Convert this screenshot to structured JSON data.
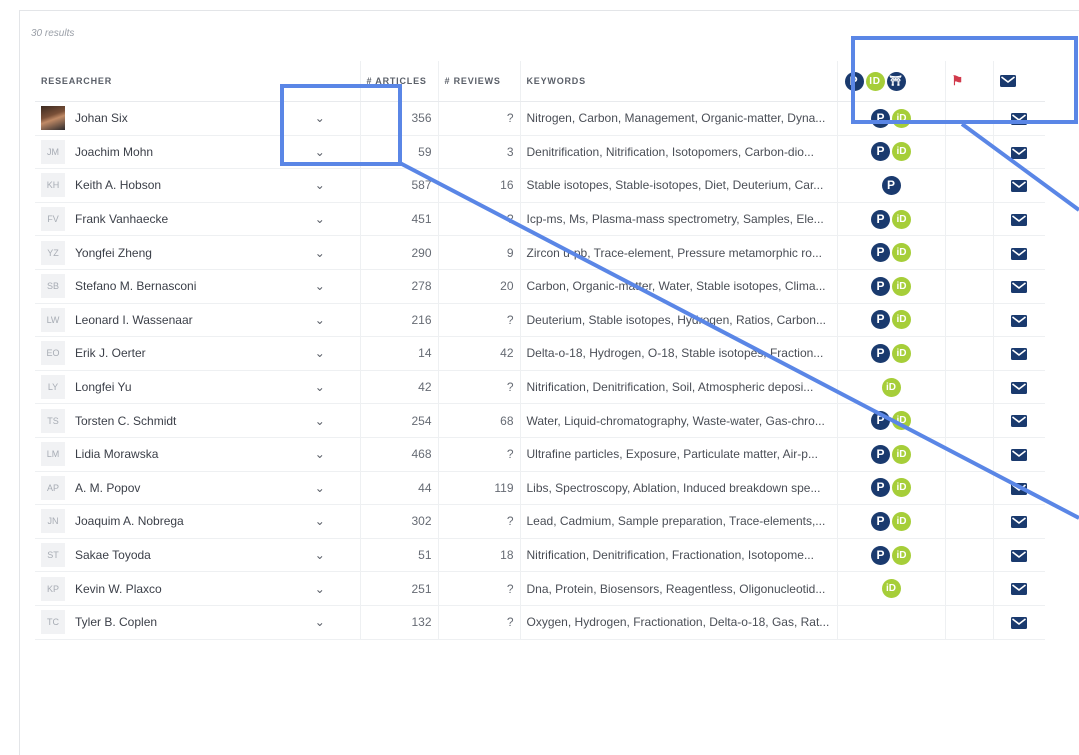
{
  "results_label": "30 results",
  "columns": {
    "researcher": "RESEARCHER",
    "articles": "# ARTICLES",
    "reviews": "# REVIEWS",
    "keywords": "KEYWORDS"
  },
  "header_icons": [
    "publons-icon",
    "orcid-icon",
    "institution-icon",
    "flag-icon",
    "mail-icon"
  ],
  "colors": {
    "highlight": "#5a86e6",
    "publons": "#1a3a6e",
    "orcid": "#a6ce39",
    "flag": "#d13a4c",
    "mail": "#1a3a6e"
  },
  "rows": [
    {
      "initials": "",
      "photo": true,
      "name": "Johan Six",
      "articles": "356",
      "reviews": "?",
      "keywords": "Nitrogen, Carbon, Management, Organic-matter, Dyna...",
      "pub": true,
      "orcid": true
    },
    {
      "initials": "JM",
      "name": "Joachim Mohn",
      "articles": "59",
      "reviews": "3",
      "keywords": "Denitrification, Nitrification, Isotopomers, Carbon-dio...",
      "pub": true,
      "orcid": true
    },
    {
      "initials": "KH",
      "name": "Keith A. Hobson",
      "articles": "587",
      "reviews": "16",
      "keywords": "Stable isotopes, Stable-isotopes, Diet, Deuterium, Car...",
      "pub": true,
      "orcid": false
    },
    {
      "initials": "FV",
      "name": "Frank Vanhaecke",
      "articles": "451",
      "reviews": "?",
      "keywords": "Icp-ms, Ms, Plasma-mass spectrometry, Samples, Ele...",
      "pub": true,
      "orcid": true
    },
    {
      "initials": "YZ",
      "name": "Yongfei Zheng",
      "articles": "290",
      "reviews": "9",
      "keywords": "Zircon u-pb, Trace-element, Pressure metamorphic ro...",
      "pub": true,
      "orcid": true
    },
    {
      "initials": "SB",
      "name": "Stefano M. Bernasconi",
      "articles": "278",
      "reviews": "20",
      "keywords": "Carbon, Organic-matter, Water, Stable isotopes, Clima...",
      "pub": true,
      "orcid": true
    },
    {
      "initials": "LW",
      "name": "Leonard I. Wassenaar",
      "articles": "216",
      "reviews": "?",
      "keywords": "Deuterium, Stable isotopes, Hydrogen, Ratios, Carbon...",
      "pub": true,
      "orcid": true
    },
    {
      "initials": "EO",
      "name": "Erik J. Oerter",
      "articles": "14",
      "reviews": "42",
      "keywords": "Delta-o-18, Hydrogen, O-18, Stable isotopes, Fraction...",
      "pub": true,
      "orcid": true
    },
    {
      "initials": "LY",
      "name": "Longfei Yu",
      "articles": "42",
      "reviews": "?",
      "keywords": "Nitrification, Denitrification, Soil, Atmospheric deposi...",
      "pub": false,
      "orcid": true
    },
    {
      "initials": "TS",
      "name": "Torsten C. Schmidt",
      "articles": "254",
      "reviews": "68",
      "keywords": "Water, Liquid-chromatography, Waste-water, Gas-chro...",
      "pub": true,
      "orcid": true
    },
    {
      "initials": "LM",
      "name": "Lidia Morawska",
      "articles": "468",
      "reviews": "?",
      "keywords": "Ultrafine particles, Exposure, Particulate matter, Air-p...",
      "pub": true,
      "orcid": true
    },
    {
      "initials": "AP",
      "name": "A. M. Popov",
      "articles": "44",
      "reviews": "119",
      "keywords": "Libs, Spectroscopy, Ablation, Induced breakdown spe...",
      "pub": true,
      "orcid": true
    },
    {
      "initials": "JN",
      "name": "Joaquim A. Nobrega",
      "articles": "302",
      "reviews": "?",
      "keywords": "Lead, Cadmium, Sample preparation, Trace-elements,...",
      "pub": true,
      "orcid": true
    },
    {
      "initials": "ST",
      "name": "Sakae Toyoda",
      "articles": "51",
      "reviews": "18",
      "keywords": "Nitrification, Denitrification, Fractionation, Isotopome...",
      "pub": true,
      "orcid": true
    },
    {
      "initials": "KP",
      "name": "Kevin W. Plaxco",
      "articles": "251",
      "reviews": "?",
      "keywords": "Dna, Protein, Biosensors, Reagentless, Oligonucleotid...",
      "pub": false,
      "orcid": true
    },
    {
      "initials": "TC",
      "name": "Tyler B. Coplen",
      "articles": "132",
      "reviews": "?",
      "keywords": "Oxygen, Hydrogen, Fractionation, Delta-o-18, Gas, Rat...",
      "pub": false,
      "orcid": false
    }
  ]
}
